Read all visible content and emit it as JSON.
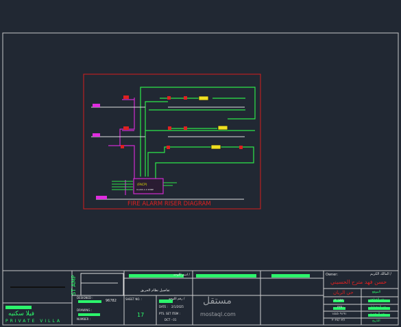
{
  "diagram": {
    "title": "FIRE ALARM RISER DIAGRAM",
    "panel_label": "(FACP)",
    "panel_sublabel": "CLASS A  2 ZONE"
  },
  "title_block": {
    "vertical_label": "ST AMP",
    "project_name_ar": "فيلا سكنيه",
    "project_name_en": "PRIVATE VILLA",
    "designed_label": "DESIGNED :",
    "drawing_label": "DRAWING :",
    "number_label": "NUMBER :",
    "number_value": "96782",
    "sheet_no_label": "SHEET NO. :",
    "sheet_no_value": "17",
    "date_label": "DATE :",
    "date_value": "2/1/2025",
    "scale_label": "PTS. SET  ITEM :",
    "scale_value": "DCT - 01",
    "drawing_title_ar": "تفاصيل نظام الحريق",
    "drawing_title_label_ar": "اسم اللوحه /",
    "sheet_label_ar": "رقم اللوحه /",
    "owner_label": "Owner:",
    "owner_label_ar": "المالك الكريم /",
    "owner_name_ar": "حسن فهد مترح الحسيني",
    "location_ar": "حي الريان",
    "plot_value": "٢٠١٤٧",
    "area_value": "٢٢٥٠",
    "permit_value": "١٤٤٥٠٩١٩١",
    "date_value_ar": "٢٠٢٤/٠٢/١",
    "row_labels_ar": [
      "الموقع",
      "رقم القطعة",
      "رقم المخطط",
      "رقم الرخصة",
      "التاريخ"
    ],
    "watermark_ar": "مستقل",
    "watermark_en": "mostaql.com"
  }
}
